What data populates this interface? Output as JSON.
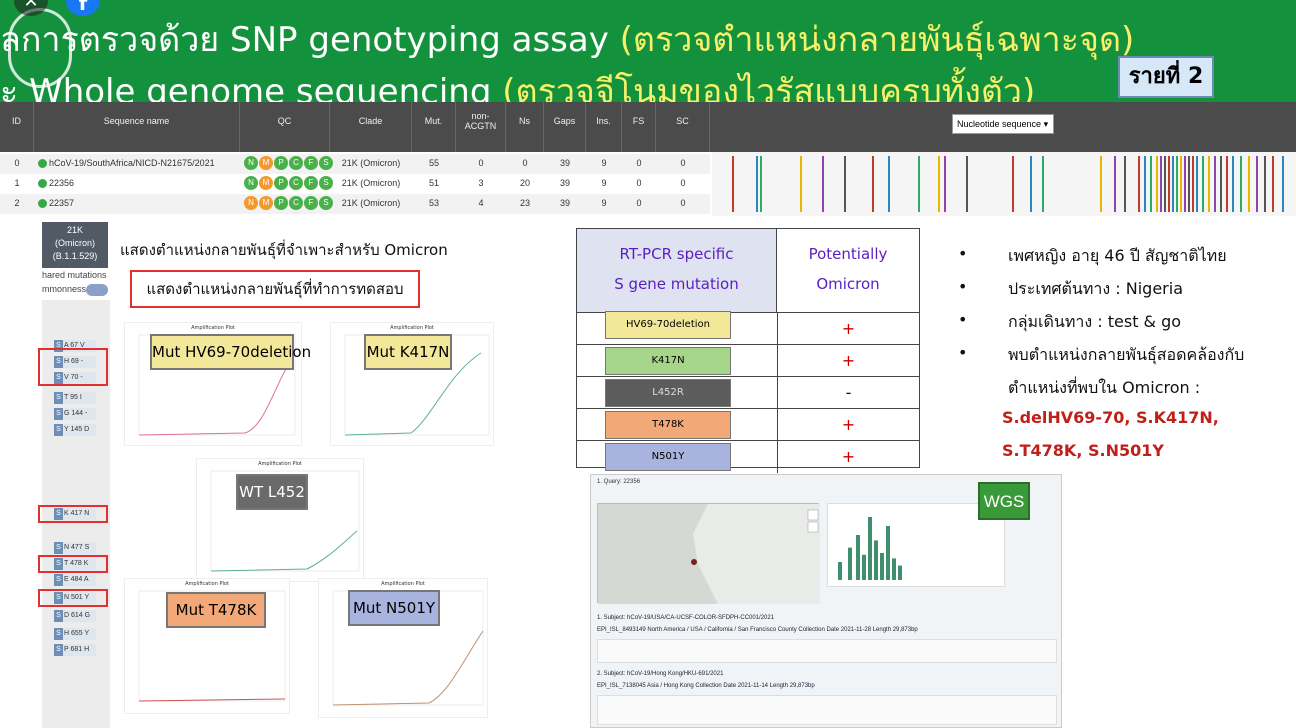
{
  "header": {
    "line1_white": "ลการตรวจด้วย SNP genotyping assay",
    "line1_yellow": "(ตรวจตำแหน่งกลายพันธุ์เฉพาะจุด)",
    "line2_white": "ะ Whole genome sequencing",
    "line2_yellow": "(ตรวจจีโนมของไวรัสแบบครบทั้งตัว)",
    "case_badge": "รายที่ 2"
  },
  "window_controls": {
    "close_icon": "close-icon",
    "facebook_icon": "facebook-icon",
    "close_glyph": "✕",
    "facebook_glyph": "f"
  },
  "table": {
    "columns": [
      "ID",
      "Sequence name",
      "QC",
      "Clade",
      "Mut.",
      "non-ACGTN",
      "Ns",
      "Gaps",
      "Ins.",
      "FS",
      "SC"
    ],
    "dropdown": "Nucleotide sequence",
    "rows": [
      {
        "id": "0",
        "name": "hCoV-19/SouthAfrica/NICD-N21675/2021",
        "clade": "21K (Omicron)",
        "mut": "55",
        "nonacgtn": "0",
        "ns": "0",
        "gaps": "39",
        "ins": "9",
        "fs": "0",
        "sc": "0"
      },
      {
        "id": "1",
        "name": "22356",
        "clade": "21K (Omicron)",
        "mut": "51",
        "nonacgtn": "3",
        "ns": "20",
        "gaps": "39",
        "ins": "9",
        "fs": "0",
        "sc": "0"
      },
      {
        "id": "2",
        "name": "22357",
        "clade": "21K (Omicron)",
        "mut": "53",
        "nonacgtn": "4",
        "ns": "23",
        "gaps": "39",
        "ins": "9",
        "fs": "0",
        "sc": "0"
      }
    ],
    "qc_letters": [
      "N",
      "M",
      "P",
      "C",
      "F",
      "S"
    ]
  },
  "clade_box": {
    "line1": "21K",
    "line2": "(Omicron)",
    "line3": "(B.1.1.529)"
  },
  "shared_label": "hared mutations",
  "commonness_label": "mmonness",
  "mutations": [
    {
      "aa": "A 67 V"
    },
    {
      "aa": "H 69 -"
    },
    {
      "aa": "V 70 -"
    },
    {
      "aa": "T 95 I"
    },
    {
      "aa": "G 144 -"
    },
    {
      "aa": "Y 145 D"
    },
    {
      "aa": "K 417 N"
    },
    {
      "aa": "N 477 S"
    },
    {
      "aa": "T 478 K"
    },
    {
      "aa": "E 484 A"
    },
    {
      "aa": "N 501 Y"
    },
    {
      "aa": "D 614 G"
    },
    {
      "aa": "H 655 Y"
    },
    {
      "aa": "P 681 H"
    }
  ],
  "notes": {
    "specific": "แสดงตำแหน่งกลายพันธุ์ที่จำเพาะสำหรับ Omicron",
    "tested": "แสดงตำแหน่งกลายพันธุ์ที่ทำการทดสอบ"
  },
  "plots": {
    "title": "Amplification Plot",
    "labels": [
      "Mut HV69-70deletion",
      "Mut K417N",
      "WT L452",
      "Mut T478K",
      "Mut N501Y"
    ],
    "colors": {
      "hv69": "#f3e79a",
      "k417n": "#f3e79a",
      "l452": "#6a6a6a",
      "t478k": "#f3a878",
      "n501y": "#a8b4de"
    }
  },
  "rtpcr": {
    "header_left_1": "RT-PCR specific",
    "header_left_2": "S gene mutation",
    "header_right_1": "Potentially",
    "header_right_2": "Omicron",
    "rows": [
      {
        "gene": "HV69-70deletion",
        "result": "+",
        "color": "#f3e79a"
      },
      {
        "gene": "K417N",
        "result": "+",
        "color": "#a6d68a"
      },
      {
        "gene": "L452R",
        "result": "-",
        "color": "#5c5c5c"
      },
      {
        "gene": "T478K",
        "result": "+",
        "color": "#f3a878"
      },
      {
        "gene": "N501Y",
        "result": "+",
        "color": "#a8b4de"
      }
    ]
  },
  "patient": {
    "b1": "เพศหญิง อายุ 46 ปี สัญชาติไทย",
    "b2": "ประเทศต้นทาง : Nigeria",
    "b3": "กลุ่มเดินทาง : test & go",
    "b4a": "พบตำแหน่งกลายพันธุ์สอดคล้องกับ",
    "b4b": "ตำแหน่งที่พบใน Omicron :",
    "mut1": "S.delHV69-70, S.K417N,",
    "mut2": "S.T478K, S.N501Y",
    "bullet": "•"
  },
  "wgs": {
    "label": "WGS",
    "query": "1. Query: 22356",
    "subject1": "1. Subject: hCoV-19/USA/CA-UCSF-COLOR-SFDPH-CC001/2021",
    "subject1_meta": "EPI_ISL_8493149   North America / USA / California / San Francisco County   Collection Date 2021-11-28  Length 29,873bp",
    "subject2": "2. Subject: hCoV-19/Hong Kong/HKU-691/2021",
    "subject2_meta": "EPI_ISL_7138045   Asia / Hong Kong   Collection Date 2021-11-14  Length 29,873bp"
  }
}
